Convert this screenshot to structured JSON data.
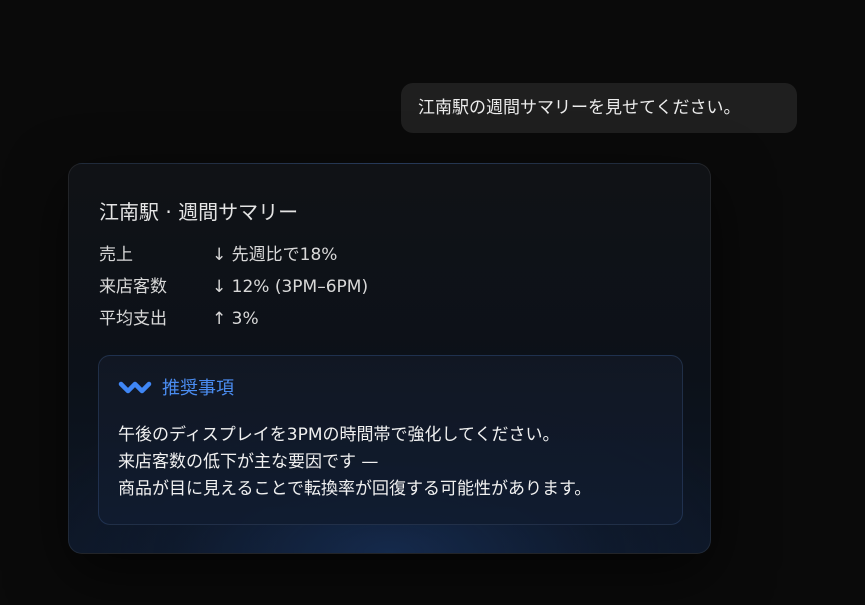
{
  "user_message": "江南駅の週間サマリーを見せてください。",
  "summary": {
    "title": "江南駅 · 週間サマリー",
    "metrics": [
      {
        "label": "売上",
        "value": "↓ 先週比で18%"
      },
      {
        "label": "来店客数",
        "value": "↓ 12% (3PM–6PM)"
      },
      {
        "label": "平均支出",
        "value": "↑ 3%"
      }
    ]
  },
  "recommendation": {
    "icon": "wave-icon",
    "heading": "推奨事項",
    "lines": [
      "午後のディスプレイを3PMの時間帯で強化してください。",
      "来店客数の低下が主な要因です —",
      "商品が目に見えることで転換率が回復する可能性があります。"
    ]
  },
  "colors": {
    "background": "#0a0a0a",
    "user_bubble": "#1f1f1f",
    "accent": "#4a8cf0"
  }
}
